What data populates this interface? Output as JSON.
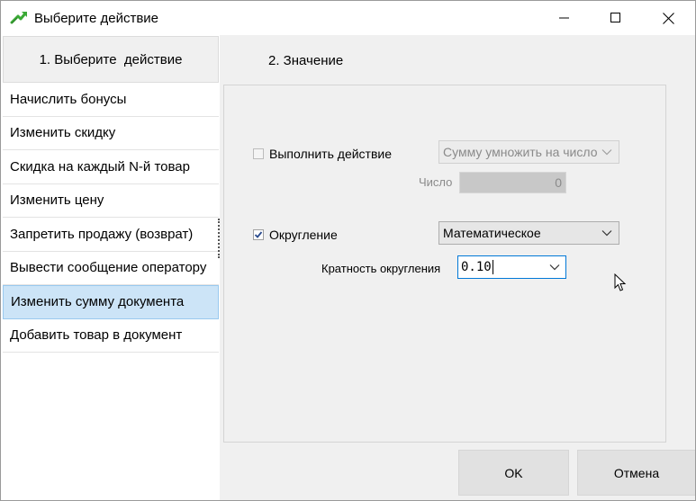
{
  "window": {
    "title": "Выберите действие",
    "controls": {
      "minimize": "minimize-icon",
      "maximize": "maximize-icon",
      "close": "close-icon"
    }
  },
  "left": {
    "header": "1. Выберите  действие",
    "items": [
      {
        "label": "Начислить бонусы"
      },
      {
        "label": "Изменить скидку"
      },
      {
        "label": "Скидка на каждый N-й товар"
      },
      {
        "label": "Изменить цену"
      },
      {
        "label": "Запретить продажу (возврат)"
      },
      {
        "label": "Вывести сообщение оператору"
      },
      {
        "label": "Изменить сумму документа",
        "selected": true
      },
      {
        "label": "Добавить товар в документ"
      }
    ]
  },
  "right": {
    "header": "2. Значение",
    "perform_action": {
      "label": "Выполнить действие",
      "checked": false,
      "enabled": false,
      "combo_value": "Сумму умножить на число"
    },
    "number": {
      "label": "Число",
      "value": "0"
    },
    "rounding": {
      "label": "Округление",
      "checked": true,
      "combo_value": "Математическое"
    },
    "rounding_step": {
      "label": "Кратность округления",
      "value": "0.10"
    }
  },
  "buttons": {
    "ok": "OK",
    "cancel": "Отмена"
  },
  "colors": {
    "selection_bg": "#cce4f7",
    "selection_border": "#99c9ef",
    "focus_border": "#0078d7",
    "app_icon_green": "#3aa935"
  }
}
